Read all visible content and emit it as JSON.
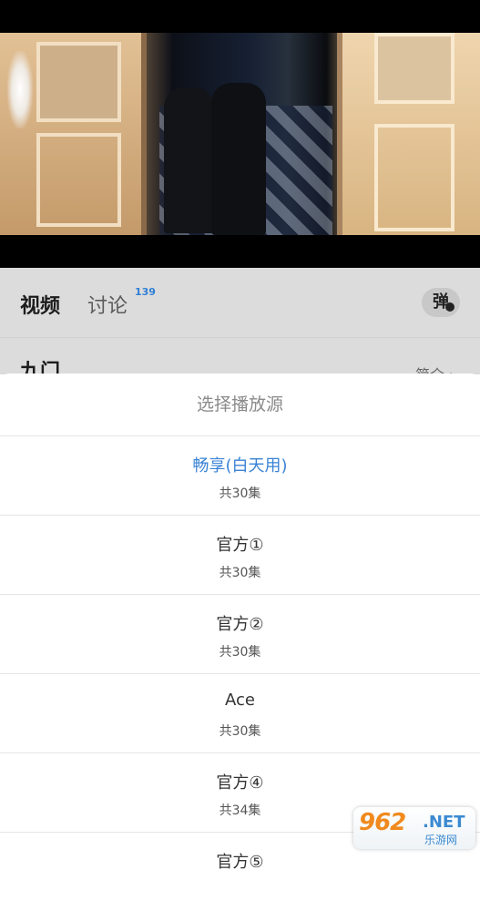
{
  "tabs": {
    "video_label": "视频",
    "discuss_label": "讨论",
    "discuss_badge": "139",
    "danmaku_label": "弹"
  },
  "section": {
    "title": "九门",
    "more_label": "简介 ›"
  },
  "source_sheet": {
    "title": "选择播放源",
    "sources": [
      {
        "name": "畅享(白天用)",
        "count": "共30集",
        "selected": true
      },
      {
        "name": "官方①",
        "count": "共30集",
        "selected": false
      },
      {
        "name": "官方②",
        "count": "共30集",
        "selected": false
      },
      {
        "name": "Ace",
        "count": "共30集",
        "selected": false
      },
      {
        "name": "官方④",
        "count": "共34集",
        "selected": false
      },
      {
        "name": "官方⑤",
        "count": "",
        "selected": false
      }
    ]
  },
  "watermark": {
    "main": "962",
    "net": ".NET",
    "sub": "乐游网"
  },
  "colors": {
    "accent": "#3a83d6",
    "watermark_orange": "#f08a1e"
  }
}
